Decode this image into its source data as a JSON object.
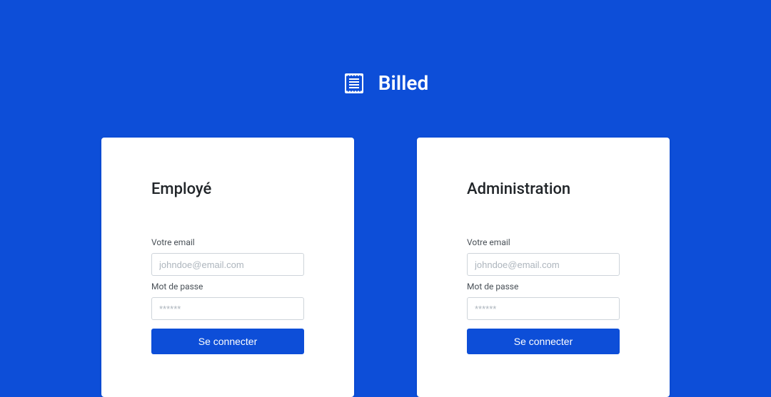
{
  "header": {
    "title": "Billed"
  },
  "employee": {
    "title": "Employé",
    "email_label": "Votre email",
    "email_placeholder": "johndoe@email.com",
    "password_label": "Mot de passe",
    "password_placeholder": "******",
    "submit_label": "Se connecter"
  },
  "admin": {
    "title": "Administration",
    "email_label": "Votre email",
    "email_placeholder": "johndoe@email.com",
    "password_label": "Mot de passe",
    "password_placeholder": "******",
    "submit_label": "Se connecter"
  }
}
